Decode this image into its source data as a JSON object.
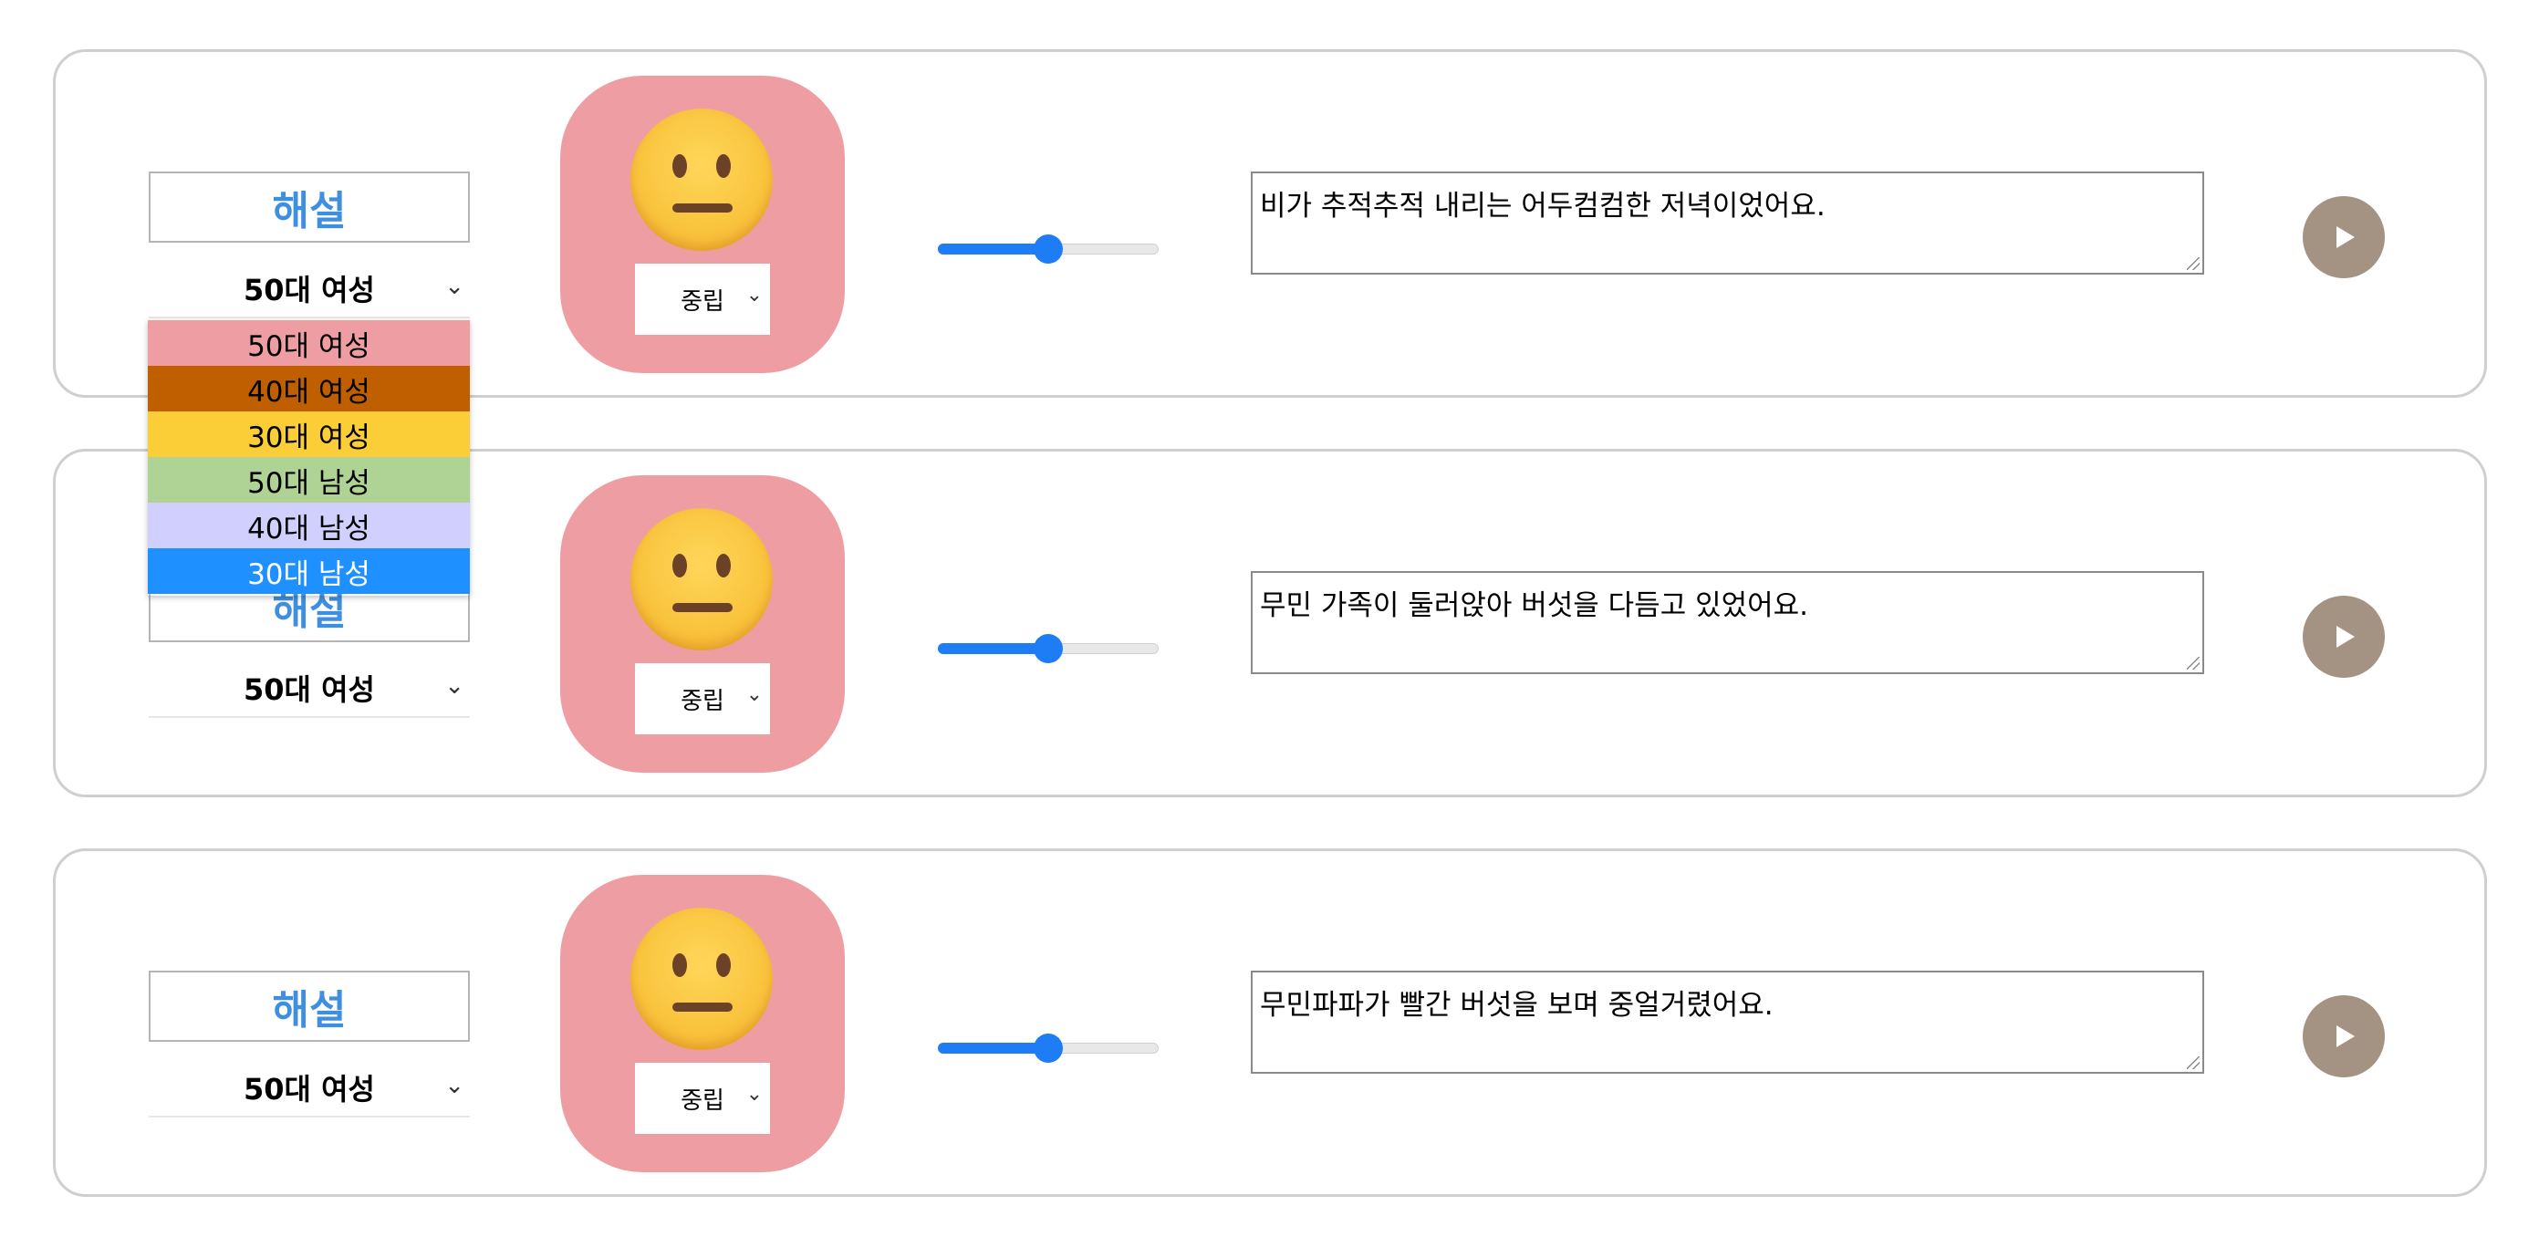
{
  "rows": [
    {
      "role_label": "해설",
      "voice": "50대 여성",
      "mood": "중립",
      "speed_level": 0.5,
      "text": "비가 추적추적 내리는 어두컴컴한 저녁이었어요."
    },
    {
      "role_label": "해설",
      "voice": "50대 여성",
      "mood": "중립",
      "speed_level": 0.5,
      "text": "무민 가족이 둘러앉아 버섯을 다듬고 있었어요."
    },
    {
      "role_label": "해설",
      "voice": "50대 여성",
      "mood": "중립",
      "speed_level": 0.5,
      "text": "무민파파가 빨간 버섯을 보며 중얼거렸어요."
    }
  ],
  "voice_dropdown": {
    "open_for_row": 1,
    "options": [
      {
        "label": "50대 여성",
        "color": "#ee9ea2"
      },
      {
        "label": "40대 여성",
        "color": "#c05f00"
      },
      {
        "label": "30대 여성",
        "color": "#fbcd36"
      },
      {
        "label": "50대 남성",
        "color": "#aed394"
      },
      {
        "label": "40대 남성",
        "color": "#d0cffe"
      },
      {
        "label": "30대 남성",
        "color": "#1e90ff",
        "highlighted": true
      }
    ]
  },
  "icons": {
    "emoji": "neutral-face-icon",
    "play": "play-icon",
    "chevron": "chevron-down-icon"
  },
  "colors": {
    "accent": "#3f8fe0",
    "emoji_card": "#ee9ea2",
    "slider": "#1e7cf4",
    "play_button": "#a49282"
  }
}
